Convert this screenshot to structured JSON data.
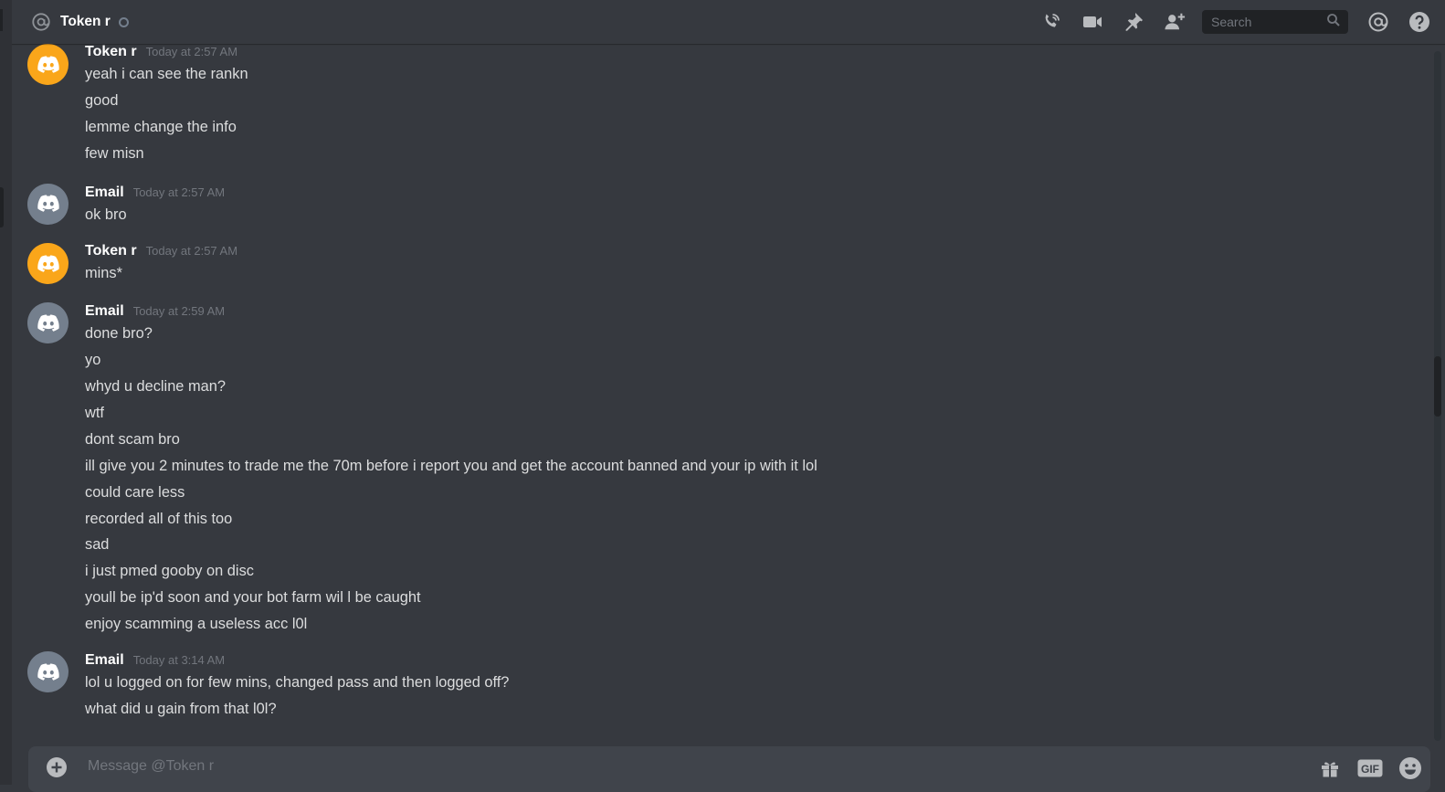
{
  "header": {
    "title": "Token r",
    "search_placeholder": "Search"
  },
  "messages": [
    {
      "author": "Token r",
      "timestamp": "Today at 2:57 AM",
      "avatar_color": "#faa61a",
      "lines": [
        "yeah i can see the rankn",
        "good",
        "lemme change the info",
        "few misn"
      ]
    },
    {
      "author": "Email",
      "timestamp": "Today at 2:57 AM",
      "avatar_color": "#747f8d",
      "lines": [
        "ok bro"
      ]
    },
    {
      "author": "Token r",
      "timestamp": "Today at 2:57 AM",
      "avatar_color": "#faa61a",
      "lines": [
        "mins*"
      ]
    },
    {
      "author": "Email",
      "timestamp": "Today at 2:59 AM",
      "avatar_color": "#747f8d",
      "lines": [
        "done bro?",
        "yo",
        "whyd u decline man?",
        "wtf",
        "dont scam bro",
        "ill give you 2 minutes to trade me the 70m before i report you and get the account banned and your ip with it lol",
        "could care less",
        "recorded all of this too",
        "sad",
        "i just pmed gooby on disc",
        "youll be ip'd soon and your bot farm wil l be caught",
        "enjoy scamming a useless acc l0l"
      ]
    },
    {
      "author": "Email",
      "timestamp": "Today at 3:14 AM",
      "avatar_color": "#747f8d",
      "lines": [
        "lol u logged on for few mins, changed pass and then logged off?",
        "what did u gain from that l0l?"
      ]
    }
  ],
  "composer": {
    "placeholder": "Message @Token r"
  },
  "icons": {
    "header": [
      "at-icon",
      "status-dot",
      "call-icon",
      "video-icon",
      "pin-icon",
      "add-friend-icon",
      "search-icon",
      "mentions-icon",
      "help-icon"
    ],
    "composer": [
      "add-attachment-icon",
      "gift-icon",
      "gif-icon",
      "emoji-icon"
    ]
  },
  "colors": {
    "background": "#36393f",
    "input": "#40444b",
    "text": "#dcddde",
    "muted": "#72767d",
    "brand_orange": "#faa61a",
    "avatar_grey": "#747f8d"
  }
}
